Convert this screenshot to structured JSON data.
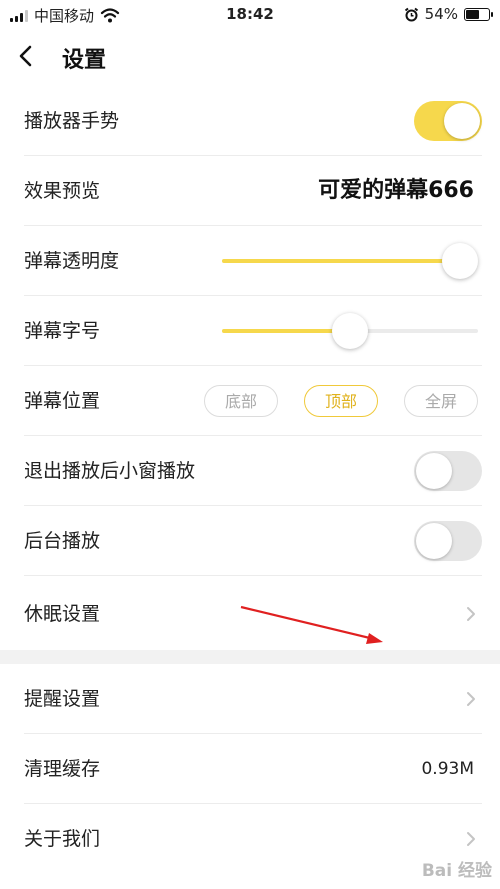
{
  "status_bar": {
    "carrier": "中国移动",
    "time": "18:42",
    "battery": "54%",
    "battery_level": 0.54
  },
  "nav": {
    "title": "设置"
  },
  "settings": {
    "player_gesture": {
      "label": "播放器手势",
      "on": true
    },
    "effect_preview": {
      "label": "效果预览",
      "value": "可爱的弹幕666"
    },
    "danmaku_opacity": {
      "label": "弹幕透明度",
      "level": 0.93
    },
    "danmaku_font_size": {
      "label": "弹幕字号",
      "level": 0.5
    },
    "danmaku_position": {
      "label": "弹幕位置",
      "options": [
        "底部",
        "顶部",
        "全屏"
      ],
      "selected": "顶部"
    },
    "pip_after_exit": {
      "label": "退出播放后小窗播放",
      "on": false
    },
    "background_play": {
      "label": "后台播放",
      "on": false
    },
    "sleep_settings": {
      "label": "休眠设置"
    },
    "reminder_settings": {
      "label": "提醒设置"
    },
    "clear_cache": {
      "label": "清理缓存",
      "value": "0.93M"
    },
    "about_us": {
      "label": "关于我们"
    }
  },
  "watermark": "Bai 经验",
  "colors": {
    "accent": "#f6d84c",
    "arrow": "#e02020"
  }
}
